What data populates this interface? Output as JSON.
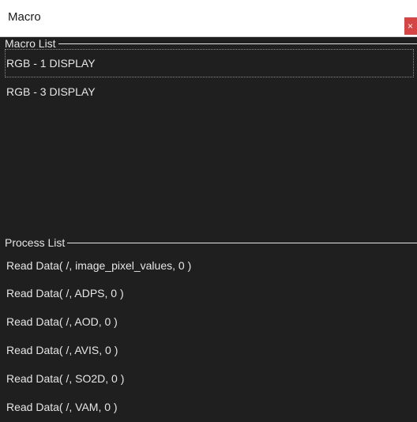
{
  "window": {
    "title": "Macro",
    "close_label": "×"
  },
  "macro_section": {
    "header": "Macro List",
    "items": [
      {
        "label": "RGB - 1 DISPLAY",
        "selected": true
      },
      {
        "label": "RGB - 3 DISPLAY",
        "selected": false
      }
    ]
  },
  "process_section": {
    "header": "Process List",
    "items": [
      {
        "label": "Read Data( /, image_pixel_values, 0 )"
      },
      {
        "label": "Read Data( /, ADPS, 0 )"
      },
      {
        "label": "Read Data( /, AOD, 0 )"
      },
      {
        "label": "Read Data( /, AVIS, 0 )"
      },
      {
        "label": "Read Data( /, SO2D, 0 )"
      },
      {
        "label": "Read Data( /, VAM, 0 )"
      }
    ]
  },
  "colors": {
    "background": "#1f1f1f",
    "text": "#e6e6e6",
    "close_button": "#d64545"
  },
  "icons": {
    "close": "close-icon"
  }
}
